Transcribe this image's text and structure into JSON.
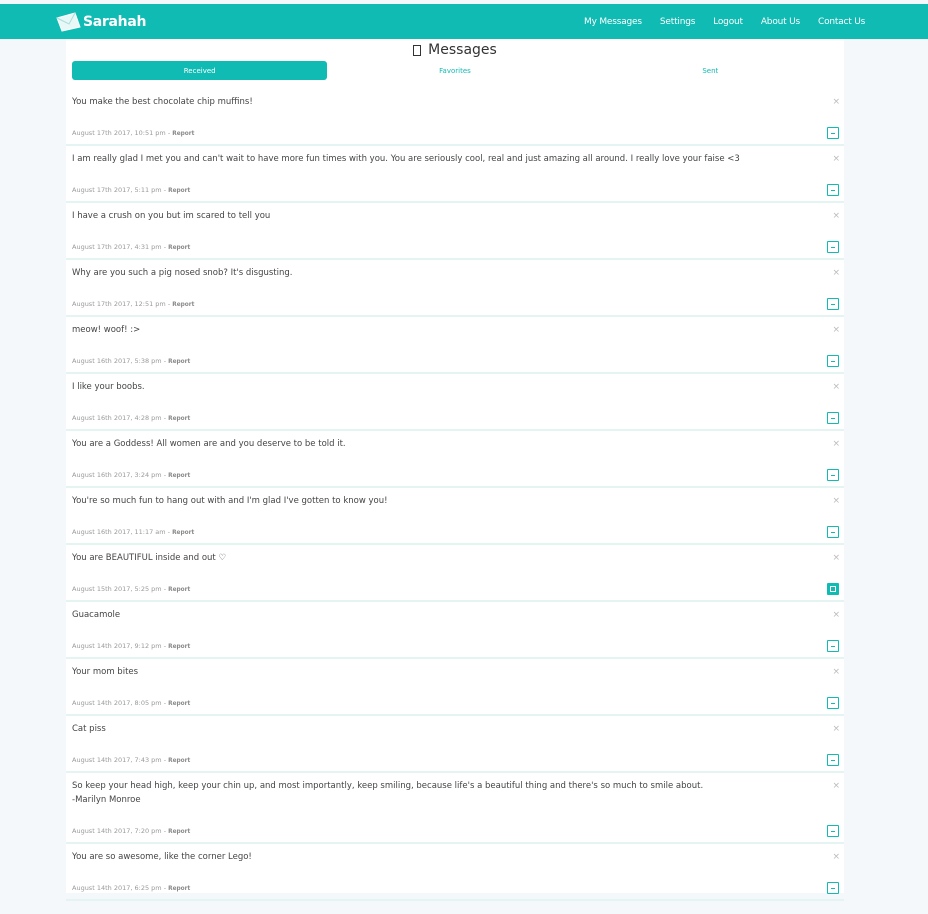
{
  "app": {
    "name": "Sarahah",
    "logo_icon": "envelope-icon"
  },
  "nav": [
    "My Messages",
    "Settings",
    "Logout",
    "About Us",
    "Contact Us"
  ],
  "page": {
    "title": "Messages",
    "title_icon": "inbox-icon"
  },
  "tabs": [
    "Received",
    "Favorites",
    "Sent"
  ],
  "report_label": "Report",
  "colors": {
    "accent": "#10bbb3",
    "background": "#f5f8fa"
  },
  "messages": [
    {
      "text": "You make the best chocolate chip muffins!",
      "date": "August 17th 2017, 10:51 pm",
      "favorite": false
    },
    {
      "text": "I am really glad I met you and can't wait to have more fun times with you. You are seriously cool, real and just amazing all around. I really love your faise <3",
      "date": "August 17th 2017, 5:11 pm",
      "favorite": false
    },
    {
      "text": "I have a crush on you but im scared to tell you",
      "date": "August 17th 2017, 4:31 pm",
      "favorite": false
    },
    {
      "text": "Why are you such a pig nosed snob? It's disgusting.",
      "date": "August 17th 2017, 12:51 pm",
      "favorite": false
    },
    {
      "text": "meow! woof! :>",
      "date": "August 16th 2017, 5:38 pm",
      "favorite": false
    },
    {
      "text": "I like your boobs.",
      "date": "August 16th 2017, 4:28 pm",
      "favorite": false
    },
    {
      "text": "You are a Goddess! All women are and you deserve to be told it.",
      "date": "August 16th 2017, 3:24 pm",
      "favorite": false
    },
    {
      "text": "You're so much fun to hang out with and I'm glad I've gotten to know you!",
      "date": "August 16th 2017, 11:17 am",
      "favorite": false
    },
    {
      "text": "You are BEAUTIFUL inside and out ♡",
      "date": "August 15th 2017, 5:25 pm",
      "favorite": true
    },
    {
      "text": "Guacamole",
      "date": "August 14th 2017, 9:12 pm",
      "favorite": false
    },
    {
      "text": "Your mom bites",
      "date": "August 14th 2017, 8:05 pm",
      "favorite": false
    },
    {
      "text": "Cat piss",
      "date": "August 14th 2017, 7:43 pm",
      "favorite": false
    },
    {
      "text": "So keep your head high, keep your chin up, and most importantly, keep smiling, because life's a beautiful thing and there's so much to smile about.\n-Marilyn Monroe",
      "date": "August 14th 2017, 7:20 pm",
      "favorite": false
    },
    {
      "text": "You are so awesome, like the corner Lego!",
      "date": "August 14th 2017, 6:25 pm",
      "favorite": false
    }
  ]
}
